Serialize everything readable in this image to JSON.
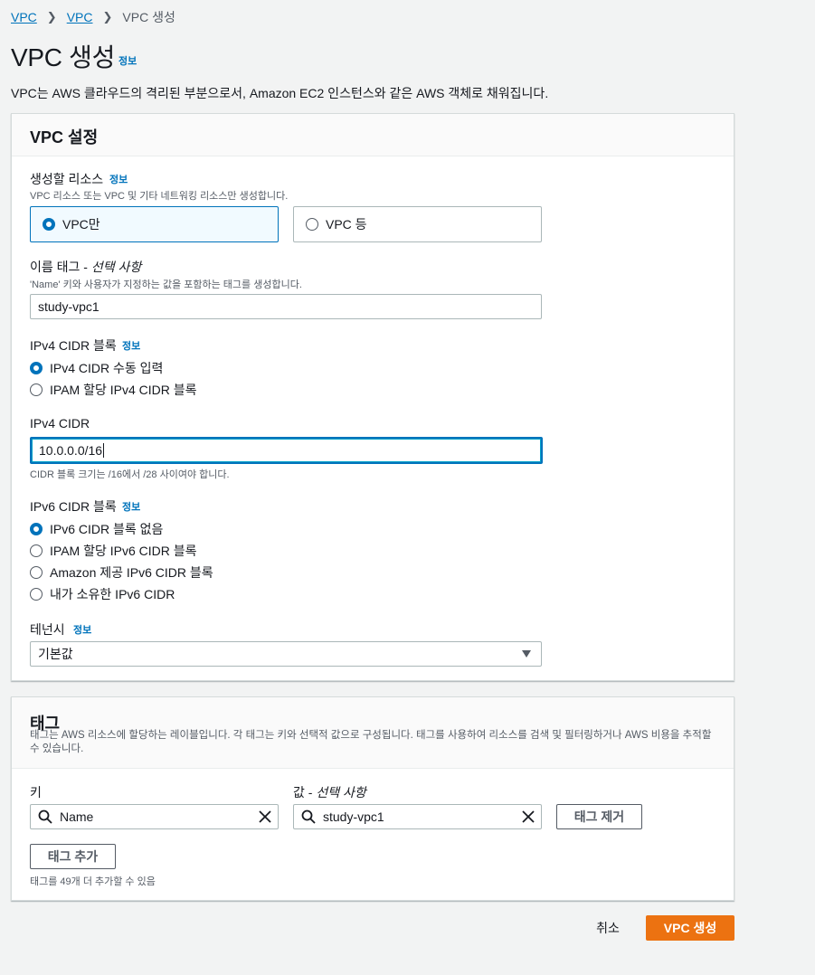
{
  "breadcrumb": {
    "items": [
      "VPC",
      "VPC"
    ],
    "current": "VPC 생성"
  },
  "page": {
    "title": "VPC 생성",
    "info": "정보",
    "description": "VPC는 AWS 클라우드의 격리된 부분으로서, Amazon EC2 인스턴스와 같은 AWS 객체로 채워집니다."
  },
  "settings": {
    "title": "VPC 설정",
    "resources": {
      "label": "생성할 리소스",
      "info": "정보",
      "description": "VPC 리소스 또는 VPC 및 기타 네트워킹 리소스만 생성합니다.",
      "options": [
        "VPC만",
        "VPC 등"
      ],
      "selected": "VPC만"
    },
    "name_tag": {
      "label": "이름 태그 - ",
      "label_optional": "선택 사항",
      "description": "'Name' 키와 사용자가 지정하는 값을 포함하는 태그를 생성합니다.",
      "value": "study-vpc1"
    },
    "ipv4_block": {
      "label": "IPv4 CIDR 블록",
      "info": "정보",
      "options": [
        "IPv4 CIDR 수동 입력",
        "IPAM 할당 IPv4 CIDR 블록"
      ],
      "selected": "IPv4 CIDR 수동 입력"
    },
    "ipv4_cidr": {
      "label": "IPv4 CIDR",
      "value": "10.0.0.0/16",
      "hint": "CIDR 블록 크기는 /16에서 /28 사이여야 합니다."
    },
    "ipv6_block": {
      "label": "IPv6 CIDR 블록",
      "info": "정보",
      "options": [
        "IPv6 CIDR 블록 없음",
        "IPAM 할당 IPv6 CIDR 블록",
        "Amazon 제공 IPv6 CIDR 블록",
        "내가 소유한 IPv6 CIDR"
      ],
      "selected": "IPv6 CIDR 블록 없음"
    },
    "tenancy": {
      "label": "테넌시",
      "info": "정보",
      "value": "기본값"
    }
  },
  "tags": {
    "title": "태그",
    "description": "태그는 AWS 리소스에 할당하는 레이블입니다. 각 태그는 키와 선택적 값으로 구성됩니다. 태그를 사용하여 리소스를 검색 및 필터링하거나 AWS 비용을 추적할 수 있습니다.",
    "key_label": "키",
    "value_label": "값 - ",
    "value_label_optional": "선택 사항",
    "rows": [
      {
        "key": "Name",
        "value": "study-vpc1"
      }
    ],
    "remove_label": "태그 제거",
    "add_label": "태그 추가",
    "limit_text": "태그를 49개 더 추가할 수 있음"
  },
  "footer": {
    "cancel": "취소",
    "create": "VPC 생성"
  },
  "colors": {
    "accent": "#0073bb",
    "primary_button": "#ec7211",
    "background": "#f2f3f3"
  }
}
